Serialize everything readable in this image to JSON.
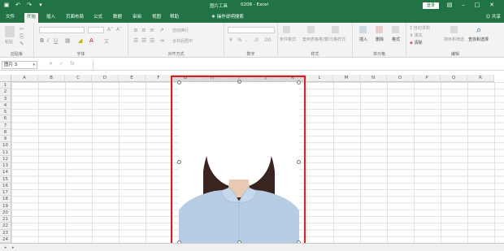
{
  "titlebar": {
    "tool_label": "图片工具",
    "doc_title": "0208 - Excel",
    "login": "登录",
    "undo_icon": "undo-icon",
    "redo_icon": "redo-icon"
  },
  "tabs": [
    {
      "label": "文件"
    },
    {
      "label": "开始"
    },
    {
      "label": "插入"
    },
    {
      "label": "页面布局"
    },
    {
      "label": "公式"
    },
    {
      "label": "数据"
    },
    {
      "label": "审阅"
    },
    {
      "label": "视图"
    },
    {
      "label": "帮助"
    },
    {
      "label": "格式"
    }
  ],
  "search_label": "操作说明搜索",
  "share_label": "共享",
  "ribbon": {
    "groups": {
      "clipboard": "剪贴板",
      "font": "字体",
      "alignment": "对齐方式",
      "number": "数字",
      "styles": "样式",
      "cells": "单元格",
      "editing": "编辑"
    },
    "paste": "粘贴",
    "wrap_text": "自动换行",
    "merge_center": "合并后居中",
    "conditional_format": "条件格式",
    "table_format": "套用表格格式",
    "cell_styles": "单元格样式",
    "insert": "插入",
    "delete": "删除",
    "format": "格式",
    "autosum": "自动求和",
    "fill": "填充",
    "clear": "清除",
    "sort_filter": "排序和筛选",
    "find_select": "查找和选择"
  },
  "formula_bar": {
    "name_box": "图片 3",
    "fx": "fx"
  },
  "columns": [
    "A",
    "B",
    "C",
    "D",
    "E",
    "F",
    "G",
    "H",
    "I",
    "J",
    "K",
    "L",
    "M",
    "N",
    "O",
    "P",
    "Q",
    "R"
  ],
  "rows": [
    "1",
    "2",
    "3",
    "4",
    "5",
    "6",
    "7",
    "8",
    "9",
    "10",
    "11",
    "12",
    "13",
    "14",
    "15",
    "16",
    "17",
    "18",
    "19",
    "20",
    "21",
    "22",
    "23",
    "24"
  ],
  "colors": {
    "accent": "#217346",
    "selection_frame": "#d71d26",
    "shirt": "#b7cde4",
    "hair": "#3a2420"
  }
}
